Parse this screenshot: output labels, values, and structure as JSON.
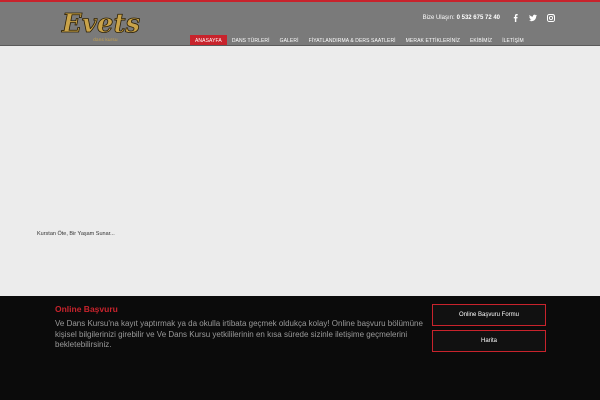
{
  "brand": {
    "logo_text": "Evets",
    "logo_subtext": "dans kursu",
    "accent": "#c8232c"
  },
  "header": {
    "contact_label": "Bize Ulaşın:",
    "phone": "0 532 675 72 40",
    "social": [
      {
        "name": "facebook-icon",
        "glyph": "f"
      },
      {
        "name": "twitter-icon",
        "glyph": "twitter"
      },
      {
        "name": "instagram-icon",
        "glyph": "instagram"
      }
    ]
  },
  "nav": {
    "items": [
      {
        "label": "ANASAYFA",
        "active": true
      },
      {
        "label": "DANS TÜRLERİ"
      },
      {
        "label": "GALERİ",
        "dropdown": true
      },
      {
        "label": "FİYATLANDIRMA & DERS SAATLERİ"
      },
      {
        "label": "MERAK ETTİKLERİNİZ"
      },
      {
        "label": "EKİBİMİZ"
      },
      {
        "label": "İLETİŞİM"
      }
    ]
  },
  "hero": {
    "tagline": "Kurstan Öte, Bir Yaşam Sunar..."
  },
  "footer": {
    "title": "Online Başvuru",
    "text": "Ve Dans Kursu'na kayıt yaptırmak ya da okulla irtibata geçmek oldukça kolay! Online başvuru bölümüne kişisel bilgilerinizi girebilir ve Ve Dans Kursu yetkililerinin en kısa sürede sizinle iletişime geçmelerini bekletebilirsiniz.",
    "button_form": "Online Başvuru Formu",
    "button_map": "Harita"
  }
}
